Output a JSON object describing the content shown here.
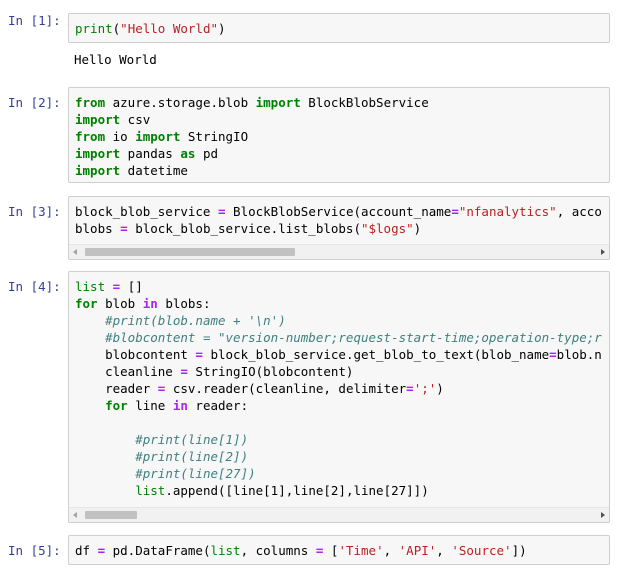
{
  "cells": [
    {
      "prompt": "In [1]:",
      "code": [
        [
          {
            "t": "print",
            "c": "bi"
          },
          {
            "t": "("
          },
          {
            "t": "\"Hello World\"",
            "c": "str"
          },
          {
            "t": ")"
          }
        ]
      ],
      "output": "Hello World"
    },
    {
      "prompt": "In [2]:",
      "code": [
        [
          {
            "t": "from",
            "c": "kw"
          },
          {
            "t": " azure.storage.blob "
          },
          {
            "t": "import",
            "c": "kw"
          },
          {
            "t": " BlockBlobService"
          }
        ],
        [
          {
            "t": "import",
            "c": "kw"
          },
          {
            "t": " csv"
          }
        ],
        [
          {
            "t": "from",
            "c": "kw"
          },
          {
            "t": " io "
          },
          {
            "t": "import",
            "c": "kw"
          },
          {
            "t": " StringIO"
          }
        ],
        [
          {
            "t": "import",
            "c": "kw"
          },
          {
            "t": " pandas "
          },
          {
            "t": "as",
            "c": "kw"
          },
          {
            "t": " pd"
          }
        ],
        [
          {
            "t": "import",
            "c": "kw"
          },
          {
            "t": " datetime"
          }
        ]
      ]
    },
    {
      "prompt": "In [3]:",
      "code": [
        [
          {
            "t": "block_blob_service "
          },
          {
            "t": "=",
            "c": "op"
          },
          {
            "t": " BlockBlobService(account_name"
          },
          {
            "t": "=",
            "c": "op"
          },
          {
            "t": "\"nfanalytics\"",
            "c": "str"
          },
          {
            "t": ", acco"
          }
        ],
        [
          {
            "t": "blobs "
          },
          {
            "t": "=",
            "c": "op"
          },
          {
            "t": " block_blob_service.list_blobs("
          },
          {
            "t": "\"$logs\"",
            "c": "str"
          },
          {
            "t": ")"
          }
        ]
      ]
    },
    {
      "prompt": "In [4]:",
      "code": [
        [
          {
            "t": "list",
            "c": "bi"
          },
          {
            "t": " "
          },
          {
            "t": "=",
            "c": "op"
          },
          {
            "t": " []"
          }
        ],
        [
          {
            "t": "for",
            "c": "kw"
          },
          {
            "t": " blob "
          },
          {
            "t": "in",
            "c": "op"
          },
          {
            "t": " blobs:"
          }
        ],
        [
          {
            "t": "    "
          },
          {
            "t": "#print(blob.name + '\\n')",
            "c": "cm"
          }
        ],
        [
          {
            "t": "    "
          },
          {
            "t": "#blobcontent = \"version-number;request-start-time;operation-type;r",
            "c": "cm"
          }
        ],
        [
          {
            "t": "    blobcontent "
          },
          {
            "t": "=",
            "c": "op"
          },
          {
            "t": " block_blob_service.get_blob_to_text(blob_name"
          },
          {
            "t": "=",
            "c": "op"
          },
          {
            "t": "blob.n"
          }
        ],
        [
          {
            "t": "    cleanline "
          },
          {
            "t": "=",
            "c": "op"
          },
          {
            "t": " StringIO(blobcontent)"
          }
        ],
        [
          {
            "t": "    reader "
          },
          {
            "t": "=",
            "c": "op"
          },
          {
            "t": " csv.reader(cleanline, delimiter"
          },
          {
            "t": "=",
            "c": "op"
          },
          {
            "t": "';'",
            "c": "str"
          },
          {
            "t": ")"
          }
        ],
        [
          {
            "t": "    "
          },
          {
            "t": "for",
            "c": "kw"
          },
          {
            "t": " line "
          },
          {
            "t": "in",
            "c": "op"
          },
          {
            "t": " reader:"
          }
        ],
        [
          {
            "t": ""
          }
        ],
        [
          {
            "t": "        "
          },
          {
            "t": "#print(line[1])",
            "c": "cm"
          }
        ],
        [
          {
            "t": "        "
          },
          {
            "t": "#print(line[2])",
            "c": "cm"
          }
        ],
        [
          {
            "t": "        "
          },
          {
            "t": "#print(line[27])",
            "c": "cm"
          }
        ],
        [
          {
            "t": "        "
          },
          {
            "t": "list",
            "c": "bi"
          },
          {
            "t": ".append([line[1],line[2],line[27]])"
          }
        ]
      ]
    },
    {
      "prompt": "In [5]:",
      "code": [
        [
          {
            "t": "df "
          },
          {
            "t": "=",
            "c": "op"
          },
          {
            "t": " pd.DataFrame("
          },
          {
            "t": "list",
            "c": "bi"
          },
          {
            "t": ", columns "
          },
          {
            "t": "=",
            "c": "op"
          },
          {
            "t": " ["
          },
          {
            "t": "'Time'",
            "c": "str"
          },
          {
            "t": ", "
          },
          {
            "t": "'API'",
            "c": "str"
          },
          {
            "t": ", "
          },
          {
            "t": "'Source'",
            "c": "str"
          },
          {
            "t": "])"
          }
        ]
      ]
    }
  ]
}
